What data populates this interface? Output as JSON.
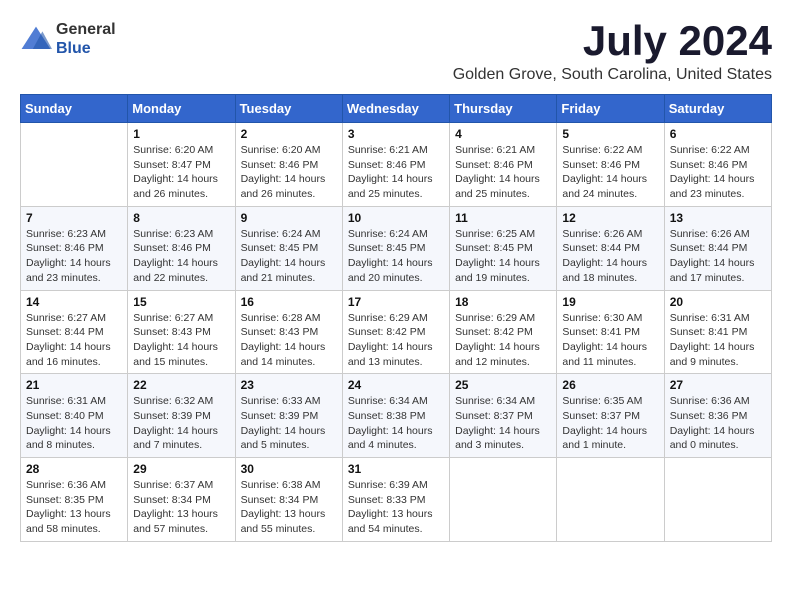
{
  "logo": {
    "general": "General",
    "blue": "Blue"
  },
  "title": {
    "month_year": "July 2024",
    "location": "Golden Grove, South Carolina, United States"
  },
  "days_of_week": [
    "Sunday",
    "Monday",
    "Tuesday",
    "Wednesday",
    "Thursday",
    "Friday",
    "Saturday"
  ],
  "weeks": [
    [
      {
        "day": "",
        "info": ""
      },
      {
        "day": "1",
        "info": "Sunrise: 6:20 AM\nSunset: 8:47 PM\nDaylight: 14 hours\nand 26 minutes."
      },
      {
        "day": "2",
        "info": "Sunrise: 6:20 AM\nSunset: 8:46 PM\nDaylight: 14 hours\nand 26 minutes."
      },
      {
        "day": "3",
        "info": "Sunrise: 6:21 AM\nSunset: 8:46 PM\nDaylight: 14 hours\nand 25 minutes."
      },
      {
        "day": "4",
        "info": "Sunrise: 6:21 AM\nSunset: 8:46 PM\nDaylight: 14 hours\nand 25 minutes."
      },
      {
        "day": "5",
        "info": "Sunrise: 6:22 AM\nSunset: 8:46 PM\nDaylight: 14 hours\nand 24 minutes."
      },
      {
        "day": "6",
        "info": "Sunrise: 6:22 AM\nSunset: 8:46 PM\nDaylight: 14 hours\nand 23 minutes."
      }
    ],
    [
      {
        "day": "7",
        "info": "Sunrise: 6:23 AM\nSunset: 8:46 PM\nDaylight: 14 hours\nand 23 minutes."
      },
      {
        "day": "8",
        "info": "Sunrise: 6:23 AM\nSunset: 8:46 PM\nDaylight: 14 hours\nand 22 minutes."
      },
      {
        "day": "9",
        "info": "Sunrise: 6:24 AM\nSunset: 8:45 PM\nDaylight: 14 hours\nand 21 minutes."
      },
      {
        "day": "10",
        "info": "Sunrise: 6:24 AM\nSunset: 8:45 PM\nDaylight: 14 hours\nand 20 minutes."
      },
      {
        "day": "11",
        "info": "Sunrise: 6:25 AM\nSunset: 8:45 PM\nDaylight: 14 hours\nand 19 minutes."
      },
      {
        "day": "12",
        "info": "Sunrise: 6:26 AM\nSunset: 8:44 PM\nDaylight: 14 hours\nand 18 minutes."
      },
      {
        "day": "13",
        "info": "Sunrise: 6:26 AM\nSunset: 8:44 PM\nDaylight: 14 hours\nand 17 minutes."
      }
    ],
    [
      {
        "day": "14",
        "info": "Sunrise: 6:27 AM\nSunset: 8:44 PM\nDaylight: 14 hours\nand 16 minutes."
      },
      {
        "day": "15",
        "info": "Sunrise: 6:27 AM\nSunset: 8:43 PM\nDaylight: 14 hours\nand 15 minutes."
      },
      {
        "day": "16",
        "info": "Sunrise: 6:28 AM\nSunset: 8:43 PM\nDaylight: 14 hours\nand 14 minutes."
      },
      {
        "day": "17",
        "info": "Sunrise: 6:29 AM\nSunset: 8:42 PM\nDaylight: 14 hours\nand 13 minutes."
      },
      {
        "day": "18",
        "info": "Sunrise: 6:29 AM\nSunset: 8:42 PM\nDaylight: 14 hours\nand 12 minutes."
      },
      {
        "day": "19",
        "info": "Sunrise: 6:30 AM\nSunset: 8:41 PM\nDaylight: 14 hours\nand 11 minutes."
      },
      {
        "day": "20",
        "info": "Sunrise: 6:31 AM\nSunset: 8:41 PM\nDaylight: 14 hours\nand 9 minutes."
      }
    ],
    [
      {
        "day": "21",
        "info": "Sunrise: 6:31 AM\nSunset: 8:40 PM\nDaylight: 14 hours\nand 8 minutes."
      },
      {
        "day": "22",
        "info": "Sunrise: 6:32 AM\nSunset: 8:39 PM\nDaylight: 14 hours\nand 7 minutes."
      },
      {
        "day": "23",
        "info": "Sunrise: 6:33 AM\nSunset: 8:39 PM\nDaylight: 14 hours\nand 5 minutes."
      },
      {
        "day": "24",
        "info": "Sunrise: 6:34 AM\nSunset: 8:38 PM\nDaylight: 14 hours\nand 4 minutes."
      },
      {
        "day": "25",
        "info": "Sunrise: 6:34 AM\nSunset: 8:37 PM\nDaylight: 14 hours\nand 3 minutes."
      },
      {
        "day": "26",
        "info": "Sunrise: 6:35 AM\nSunset: 8:37 PM\nDaylight: 14 hours\nand 1 minute."
      },
      {
        "day": "27",
        "info": "Sunrise: 6:36 AM\nSunset: 8:36 PM\nDaylight: 14 hours\nand 0 minutes."
      }
    ],
    [
      {
        "day": "28",
        "info": "Sunrise: 6:36 AM\nSunset: 8:35 PM\nDaylight: 13 hours\nand 58 minutes."
      },
      {
        "day": "29",
        "info": "Sunrise: 6:37 AM\nSunset: 8:34 PM\nDaylight: 13 hours\nand 57 minutes."
      },
      {
        "day": "30",
        "info": "Sunrise: 6:38 AM\nSunset: 8:34 PM\nDaylight: 13 hours\nand 55 minutes."
      },
      {
        "day": "31",
        "info": "Sunrise: 6:39 AM\nSunset: 8:33 PM\nDaylight: 13 hours\nand 54 minutes."
      },
      {
        "day": "",
        "info": ""
      },
      {
        "day": "",
        "info": ""
      },
      {
        "day": "",
        "info": ""
      }
    ]
  ]
}
